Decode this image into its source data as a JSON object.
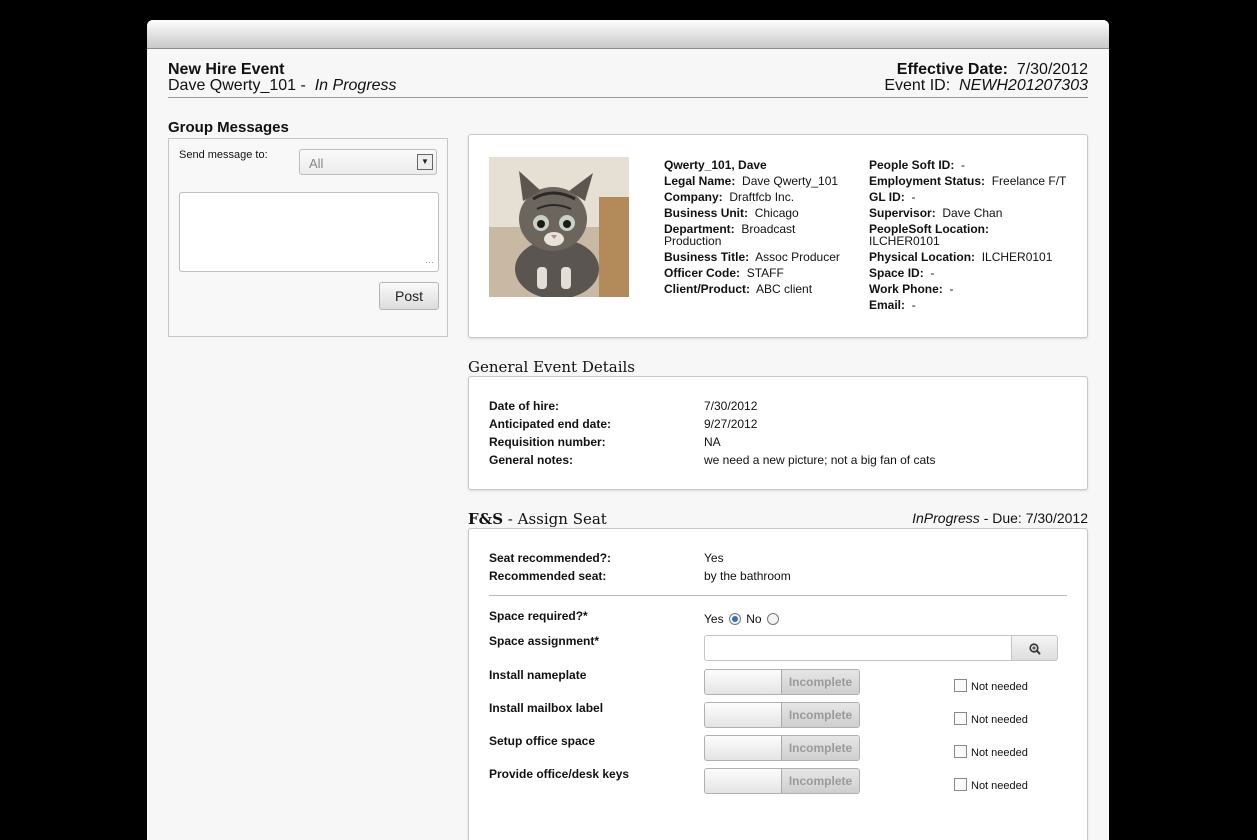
{
  "header": {
    "title": "New Hire Event",
    "employee": "Dave Qwerty_101",
    "separator": " - ",
    "status": "In Progress",
    "effective_label": "Effective Date:",
    "effective_value": "7/30/2012",
    "event_label": "Event ID:",
    "event_value": "NEWH201207303"
  },
  "group_messages": {
    "title": "Group Messages",
    "send_label": "Send message to:",
    "recipient_selected": "All",
    "message_value": "",
    "post_label": "Post"
  },
  "profile": {
    "photo_alt": "kitten",
    "name": "Qwerty_101, Dave",
    "left": [
      {
        "label": "Legal Name:",
        "value": "Dave Qwerty_101"
      },
      {
        "label": "Company:",
        "value": "Draftfcb Inc."
      },
      {
        "label": "Business Unit:",
        "value": "Chicago"
      },
      {
        "label": "Department:",
        "value": "Broadcast Production"
      },
      {
        "label": "Business Title:",
        "value": "Assoc Producer"
      },
      {
        "label": "Officer Code:",
        "value": "STAFF"
      },
      {
        "label": "Client/Product:",
        "value": "ABC client"
      }
    ],
    "right": [
      {
        "label": "People Soft ID:",
        "value": "-"
      },
      {
        "label": "Employment Status:",
        "value": "Freelance F/T"
      },
      {
        "label": "GL ID:",
        "value": "-"
      },
      {
        "label": "Supervisor:",
        "value": "Dave Chan"
      },
      {
        "label": "PeopleSoft Location:",
        "value": "ILCHER0101"
      },
      {
        "label": "Physical Location:",
        "value": "ILCHER0101"
      },
      {
        "label": "Space ID:",
        "value": "-"
      },
      {
        "label": "Work Phone:",
        "value": "-"
      },
      {
        "label": "Email:",
        "value": "-"
      }
    ]
  },
  "general_details": {
    "title": "General Event Details",
    "rows": [
      {
        "label": "Date of hire:",
        "value": "7/30/2012"
      },
      {
        "label": "Anticipated end date:",
        "value": "9/27/2012"
      },
      {
        "label": "Requisition number:",
        "value": "NA"
      },
      {
        "label": "General notes:",
        "value": "we need a new picture; not a big fan of cats"
      }
    ]
  },
  "assign_seat": {
    "title_bold": "F&S",
    "title_rest": " - Assign Seat",
    "status": "InProgress",
    "due": " - Due: 7/30/2012",
    "seat_recommended_label": "Seat recommended?:",
    "seat_recommended_value": "Yes",
    "recommended_seat_label": "Recommended seat:",
    "recommended_seat_value": "by the bathroom",
    "space_required_label": "Space required?*",
    "yes_label": "Yes",
    "no_label": "No",
    "space_required_selected": "Yes",
    "space_assignment_label": "Space assignment*",
    "space_assignment_value": "",
    "tasks": [
      {
        "label": "Install nameplate",
        "state": "Incomplete",
        "not_needed_label": "Not needed"
      },
      {
        "label": "Install mailbox label",
        "state": "Incomplete",
        "not_needed_label": "Not needed"
      },
      {
        "label": "Setup office space",
        "state": "Incomplete",
        "not_needed_label": "Not needed"
      },
      {
        "label": "Provide office/desk keys",
        "state": "Incomplete",
        "not_needed_label": "Not needed"
      }
    ]
  },
  "colors": {
    "background": "#000000",
    "page": "#f7f7f7",
    "radio_selected": "#3d6fb0"
  },
  "icons": {
    "select_arrow": "triangle-down-icon",
    "search": "magnifier-plus-icon",
    "resize": "resize-grip-icon"
  }
}
